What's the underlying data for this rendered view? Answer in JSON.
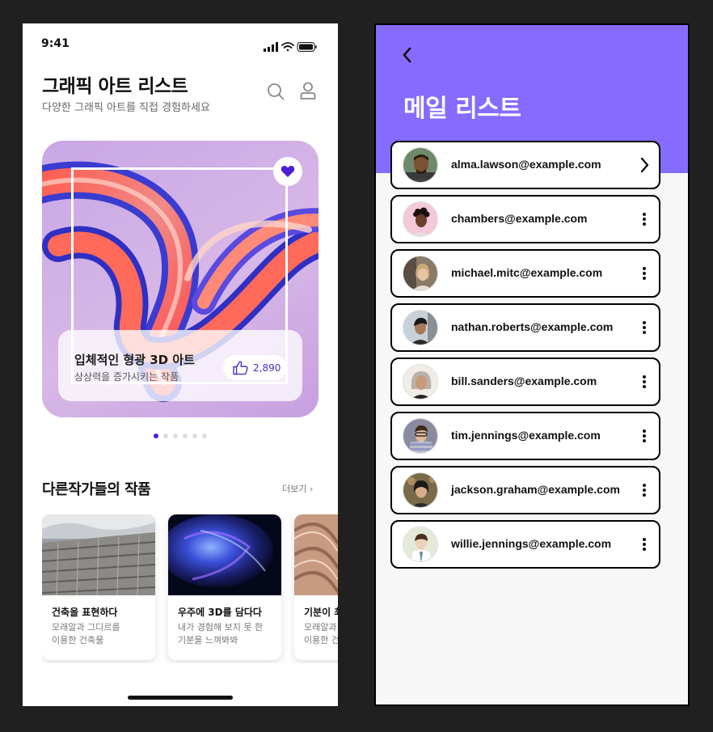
{
  "left_screen": {
    "status": {
      "time": "9:41"
    },
    "header": {
      "title": "그래픽 아트 리스트",
      "subtitle": "다양한 그래픽 아트를 직접 경험하세요"
    },
    "hero": {
      "title": "입체적인 형광 3D 아트",
      "subtitle": "상상력을 증가시키는 작품",
      "likes": "2,890"
    },
    "carousel": {
      "total": 6,
      "active": 0
    },
    "section": {
      "title": "다른작가들의 작품",
      "more": "더보기 ›"
    },
    "works": [
      {
        "title": "건축을 표현하다",
        "desc1": "모래알과 그디르를",
        "desc2": "이용한 건축물"
      },
      {
        "title": "우주에 3D를 담다다",
        "desc1": "내가 경험해 보지 못 한",
        "desc2": "기분을 느껴봐봐"
      },
      {
        "title": "기분이 최",
        "desc1": "모래알과",
        "desc2": "이용한 건"
      }
    ]
  },
  "right_screen": {
    "title": "메일 리스트",
    "mails": [
      {
        "email": "alma.lawson@example.com",
        "action": "chevron-right-icon"
      },
      {
        "email": "chambers@example.com",
        "action": "more-vertical-icon"
      },
      {
        "email": "michael.mitc@example.com",
        "action": "more-vertical-icon"
      },
      {
        "email": "nathan.roberts@example.com",
        "action": "more-vertical-icon"
      },
      {
        "email": "bill.sanders@example.com",
        "action": "more-vertical-icon"
      },
      {
        "email": "tim.jennings@example.com",
        "action": "more-vertical-icon"
      },
      {
        "email": "jackson.graham@example.com",
        "action": "more-vertical-icon"
      },
      {
        "email": "willie.jennings@example.com",
        "action": "more-vertical-icon"
      }
    ]
  },
  "colors": {
    "accent_purple": "#866bff",
    "active_dot": "#4a1fd6",
    "like_text": "#4a2ec9"
  }
}
